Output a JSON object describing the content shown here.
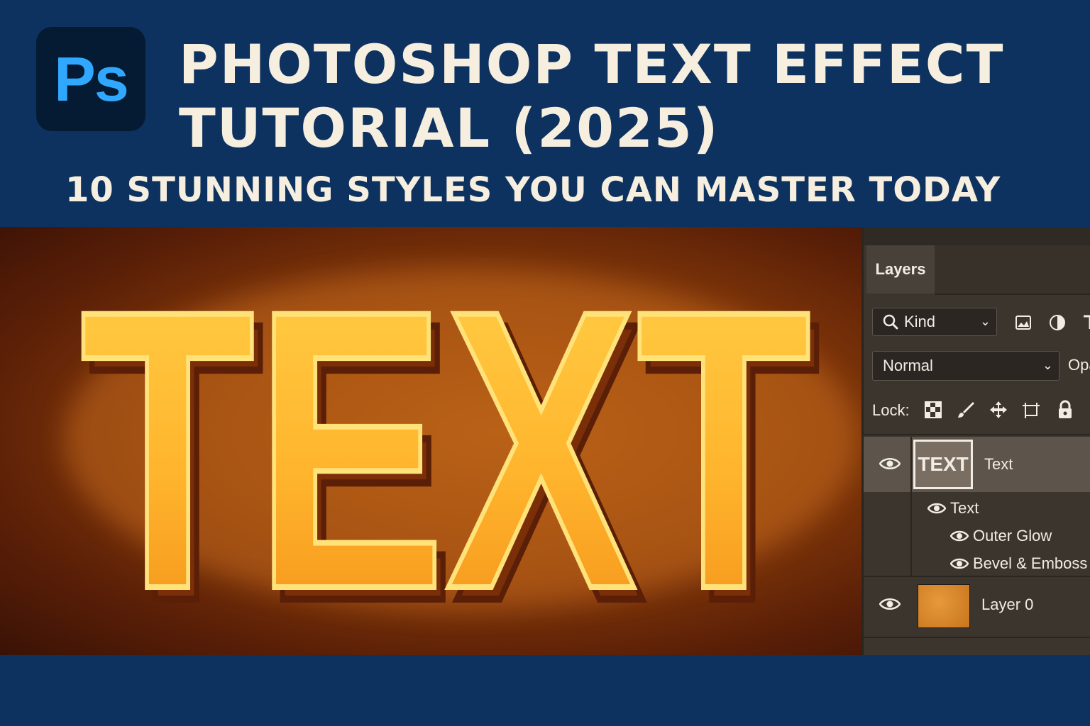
{
  "header": {
    "logo_text": "Ps",
    "title_line1": "PHOTOSHOP TEXT EFFECT",
    "title_line2": "TUTORIAL (2025)",
    "subtitle": "10 STUNNING STYLES YOU CAN MASTER TODAY"
  },
  "canvas": {
    "effect_text": "TEXT"
  },
  "layers_panel": {
    "tab_label": "Layers",
    "kind_filter": "Kind",
    "blend_mode": "Normal",
    "opacity_label": "Opacity:",
    "lock_label": "Lock:",
    "layers": [
      {
        "thumbnail_text": "TEXT",
        "name": "Text",
        "effects_group": "Text",
        "effects": [
          "Outer Glow",
          "Bevel & Emboss"
        ]
      },
      {
        "name": "Layer 0"
      }
    ]
  },
  "colors": {
    "background_navy": "#0d3260",
    "title_cream": "#f6efdf",
    "ps_blue": "#31a8ff",
    "text_gold": "#ffc43d",
    "panel_dark": "#3b352d"
  }
}
